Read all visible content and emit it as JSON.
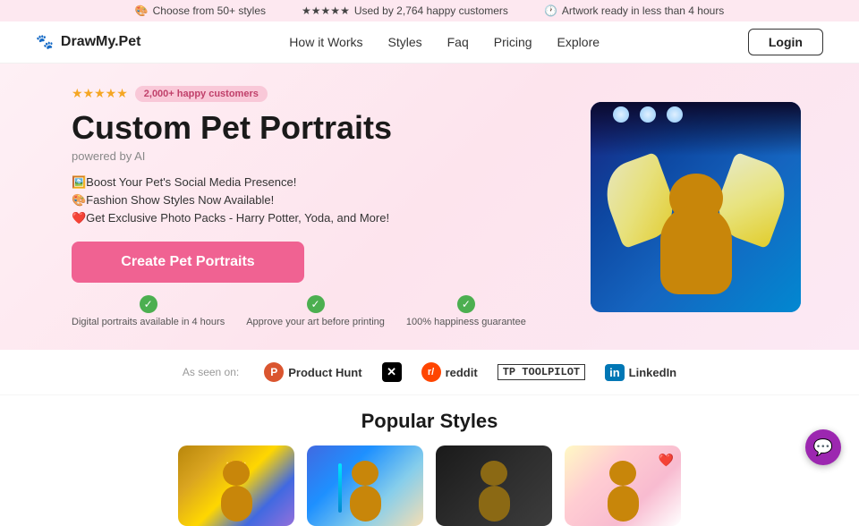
{
  "banner": {
    "item1": "Choose from 50+ styles",
    "item2": "Used by 2,764 happy customers",
    "item3": "Artwork ready in less than 4 hours",
    "star_rating": "★★★★★"
  },
  "nav": {
    "logo_text": "DrawMy.Pet",
    "links": [
      "How it Works",
      "Styles",
      "Faq",
      "Pricing",
      "Explore"
    ],
    "login_label": "Login"
  },
  "hero": {
    "stars": "★★★★★",
    "badge": "2,000+ happy customers",
    "title": "Custom Pet Portraits",
    "subtitle": "powered by AI",
    "features": [
      "🖼️Boost Your Pet's Social Media Presence!",
      "🎨Fashion Show Styles Now Available!",
      "❤️Get Exclusive Photo Packs - Harry Potter, Yoda, and More!"
    ],
    "cta_label": "Create Pet Portraits",
    "check1_label": "Digital portraits available in 4 hours",
    "check2_label": "Approve your art before printing",
    "check3_label": "100% happiness guarantee"
  },
  "as_seen_on": {
    "label": "As seen on:",
    "brands": [
      "Product Hunt",
      "X",
      "reddit",
      "TOOLPILOT",
      "LinkedIn"
    ]
  },
  "popular_styles": {
    "title": "Popular Styles"
  },
  "chat": {
    "icon": "💬"
  }
}
